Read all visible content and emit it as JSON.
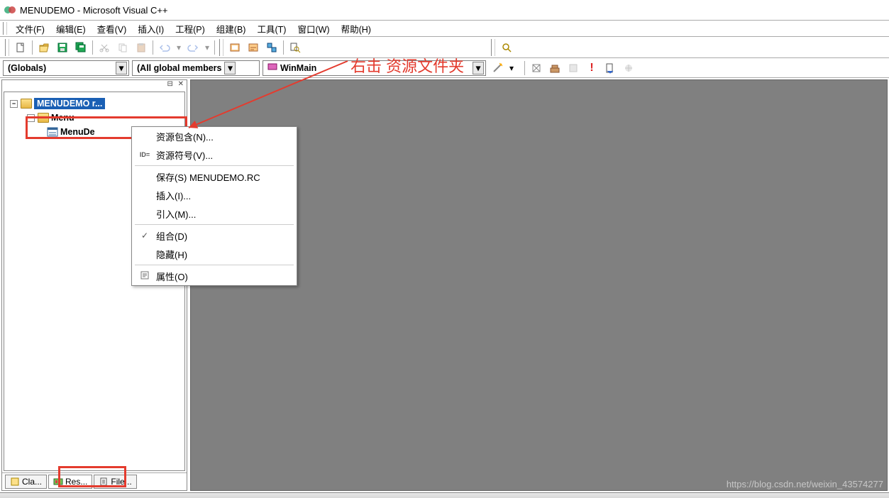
{
  "title": "MENUDEMO - Microsoft Visual C++",
  "menubar": {
    "file": "文件(F)",
    "edit": "编辑(E)",
    "view": "查看(V)",
    "insert": "插入(I)",
    "project": "工程(P)",
    "build": "组建(B)",
    "tools": "工具(T)",
    "window": "窗口(W)",
    "help": "帮助(H)"
  },
  "combos": {
    "scope": "(Globals)",
    "members": "(All global members",
    "func": "WinMain"
  },
  "tree": {
    "root": "MENUDEMO r...",
    "folder": "Menu",
    "item": "MenuDe"
  },
  "tabs": {
    "class": "Cla...",
    "resource": "Res...",
    "file": "File..."
  },
  "ctx": {
    "resinc": "资源包含(N)...",
    "ressym": "资源符号(V)...",
    "save": "保存(S) MENUDEMO.RC",
    "insert": "插入(I)...",
    "import": "引入(M)...",
    "group": "组合(D)",
    "hide": "隐藏(H)",
    "props": "属性(O)"
  },
  "annotation": "右击 资源文件夹",
  "watermark": "https://blog.csdn.net/weixin_43574277"
}
